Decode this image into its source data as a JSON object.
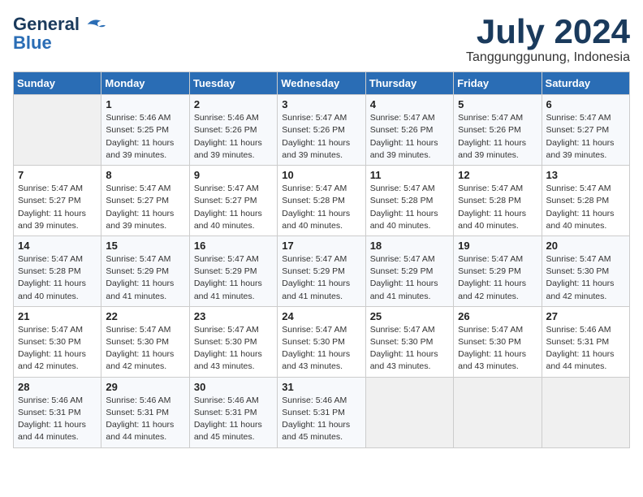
{
  "header": {
    "logo_general": "General",
    "logo_blue": "Blue",
    "month_title": "July 2024",
    "location": "Tanggunggunung, Indonesia"
  },
  "weekdays": [
    "Sunday",
    "Monday",
    "Tuesday",
    "Wednesday",
    "Thursday",
    "Friday",
    "Saturday"
  ],
  "weeks": [
    [
      {
        "day": "",
        "sunrise": "",
        "sunset": "",
        "daylight": ""
      },
      {
        "day": "1",
        "sunrise": "Sunrise: 5:46 AM",
        "sunset": "Sunset: 5:25 PM",
        "daylight": "Daylight: 11 hours and 39 minutes."
      },
      {
        "day": "2",
        "sunrise": "Sunrise: 5:46 AM",
        "sunset": "Sunset: 5:26 PM",
        "daylight": "Daylight: 11 hours and 39 minutes."
      },
      {
        "day": "3",
        "sunrise": "Sunrise: 5:47 AM",
        "sunset": "Sunset: 5:26 PM",
        "daylight": "Daylight: 11 hours and 39 minutes."
      },
      {
        "day": "4",
        "sunrise": "Sunrise: 5:47 AM",
        "sunset": "Sunset: 5:26 PM",
        "daylight": "Daylight: 11 hours and 39 minutes."
      },
      {
        "day": "5",
        "sunrise": "Sunrise: 5:47 AM",
        "sunset": "Sunset: 5:26 PM",
        "daylight": "Daylight: 11 hours and 39 minutes."
      },
      {
        "day": "6",
        "sunrise": "Sunrise: 5:47 AM",
        "sunset": "Sunset: 5:27 PM",
        "daylight": "Daylight: 11 hours and 39 minutes."
      }
    ],
    [
      {
        "day": "7",
        "sunrise": "Sunrise: 5:47 AM",
        "sunset": "Sunset: 5:27 PM",
        "daylight": "Daylight: 11 hours and 39 minutes."
      },
      {
        "day": "8",
        "sunrise": "Sunrise: 5:47 AM",
        "sunset": "Sunset: 5:27 PM",
        "daylight": "Daylight: 11 hours and 39 minutes."
      },
      {
        "day": "9",
        "sunrise": "Sunrise: 5:47 AM",
        "sunset": "Sunset: 5:27 PM",
        "daylight": "Daylight: 11 hours and 40 minutes."
      },
      {
        "day": "10",
        "sunrise": "Sunrise: 5:47 AM",
        "sunset": "Sunset: 5:28 PM",
        "daylight": "Daylight: 11 hours and 40 minutes."
      },
      {
        "day": "11",
        "sunrise": "Sunrise: 5:47 AM",
        "sunset": "Sunset: 5:28 PM",
        "daylight": "Daylight: 11 hours and 40 minutes."
      },
      {
        "day": "12",
        "sunrise": "Sunrise: 5:47 AM",
        "sunset": "Sunset: 5:28 PM",
        "daylight": "Daylight: 11 hours and 40 minutes."
      },
      {
        "day": "13",
        "sunrise": "Sunrise: 5:47 AM",
        "sunset": "Sunset: 5:28 PM",
        "daylight": "Daylight: 11 hours and 40 minutes."
      }
    ],
    [
      {
        "day": "14",
        "sunrise": "Sunrise: 5:47 AM",
        "sunset": "Sunset: 5:28 PM",
        "daylight": "Daylight: 11 hours and 40 minutes."
      },
      {
        "day": "15",
        "sunrise": "Sunrise: 5:47 AM",
        "sunset": "Sunset: 5:29 PM",
        "daylight": "Daylight: 11 hours and 41 minutes."
      },
      {
        "day": "16",
        "sunrise": "Sunrise: 5:47 AM",
        "sunset": "Sunset: 5:29 PM",
        "daylight": "Daylight: 11 hours and 41 minutes."
      },
      {
        "day": "17",
        "sunrise": "Sunrise: 5:47 AM",
        "sunset": "Sunset: 5:29 PM",
        "daylight": "Daylight: 11 hours and 41 minutes."
      },
      {
        "day": "18",
        "sunrise": "Sunrise: 5:47 AM",
        "sunset": "Sunset: 5:29 PM",
        "daylight": "Daylight: 11 hours and 41 minutes."
      },
      {
        "day": "19",
        "sunrise": "Sunrise: 5:47 AM",
        "sunset": "Sunset: 5:29 PM",
        "daylight": "Daylight: 11 hours and 42 minutes."
      },
      {
        "day": "20",
        "sunrise": "Sunrise: 5:47 AM",
        "sunset": "Sunset: 5:30 PM",
        "daylight": "Daylight: 11 hours and 42 minutes."
      }
    ],
    [
      {
        "day": "21",
        "sunrise": "Sunrise: 5:47 AM",
        "sunset": "Sunset: 5:30 PM",
        "daylight": "Daylight: 11 hours and 42 minutes."
      },
      {
        "day": "22",
        "sunrise": "Sunrise: 5:47 AM",
        "sunset": "Sunset: 5:30 PM",
        "daylight": "Daylight: 11 hours and 42 minutes."
      },
      {
        "day": "23",
        "sunrise": "Sunrise: 5:47 AM",
        "sunset": "Sunset: 5:30 PM",
        "daylight": "Daylight: 11 hours and 43 minutes."
      },
      {
        "day": "24",
        "sunrise": "Sunrise: 5:47 AM",
        "sunset": "Sunset: 5:30 PM",
        "daylight": "Daylight: 11 hours and 43 minutes."
      },
      {
        "day": "25",
        "sunrise": "Sunrise: 5:47 AM",
        "sunset": "Sunset: 5:30 PM",
        "daylight": "Daylight: 11 hours and 43 minutes."
      },
      {
        "day": "26",
        "sunrise": "Sunrise: 5:47 AM",
        "sunset": "Sunset: 5:30 PM",
        "daylight": "Daylight: 11 hours and 43 minutes."
      },
      {
        "day": "27",
        "sunrise": "Sunrise: 5:46 AM",
        "sunset": "Sunset: 5:31 PM",
        "daylight": "Daylight: 11 hours and 44 minutes."
      }
    ],
    [
      {
        "day": "28",
        "sunrise": "Sunrise: 5:46 AM",
        "sunset": "Sunset: 5:31 PM",
        "daylight": "Daylight: 11 hours and 44 minutes."
      },
      {
        "day": "29",
        "sunrise": "Sunrise: 5:46 AM",
        "sunset": "Sunset: 5:31 PM",
        "daylight": "Daylight: 11 hours and 44 minutes."
      },
      {
        "day": "30",
        "sunrise": "Sunrise: 5:46 AM",
        "sunset": "Sunset: 5:31 PM",
        "daylight": "Daylight: 11 hours and 45 minutes."
      },
      {
        "day": "31",
        "sunrise": "Sunrise: 5:46 AM",
        "sunset": "Sunset: 5:31 PM",
        "daylight": "Daylight: 11 hours and 45 minutes."
      },
      {
        "day": "",
        "sunrise": "",
        "sunset": "",
        "daylight": ""
      },
      {
        "day": "",
        "sunrise": "",
        "sunset": "",
        "daylight": ""
      },
      {
        "day": "",
        "sunrise": "",
        "sunset": "",
        "daylight": ""
      }
    ]
  ]
}
